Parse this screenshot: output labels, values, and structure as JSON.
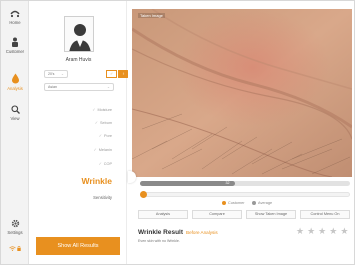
{
  "nav": {
    "items": [
      {
        "label": "Home",
        "icon": "home-icon"
      },
      {
        "label": "Customer",
        "icon": "customer-icon"
      },
      {
        "label": "Analysis",
        "icon": "analysis-icon",
        "active": true
      },
      {
        "label": "View",
        "icon": "view-icon"
      }
    ],
    "settings_label": "Settings"
  },
  "profile": {
    "name": "Aram Huvis",
    "age_select": "20's",
    "gender_male": "♂",
    "gender_female": "♀",
    "ethnicity_select": "Asian"
  },
  "analysis_items": [
    {
      "label": "Moisture"
    },
    {
      "label": "Sebum"
    },
    {
      "label": "Pore"
    },
    {
      "label": "Melanin"
    },
    {
      "label": "COP"
    }
  ],
  "current_item": "Wrinkle",
  "sensitivity_label": "Sensitivity",
  "show_all_label": "Show All Results",
  "image": {
    "label": "Taken Image"
  },
  "score": {
    "value": "32",
    "fraction": 0.45
  },
  "legend": {
    "customer": "Customer",
    "average": "Average"
  },
  "buttons": {
    "analysis": "Analysis",
    "compare": "Compare",
    "show_taken": "Show Taken Image",
    "control_menu": "Control Menu On"
  },
  "result": {
    "title": "Wrinkle Result",
    "subtitle": "Before Analysis",
    "note": "Even skin with no Wrinkle."
  },
  "colors": {
    "accent": "#e8901f"
  }
}
